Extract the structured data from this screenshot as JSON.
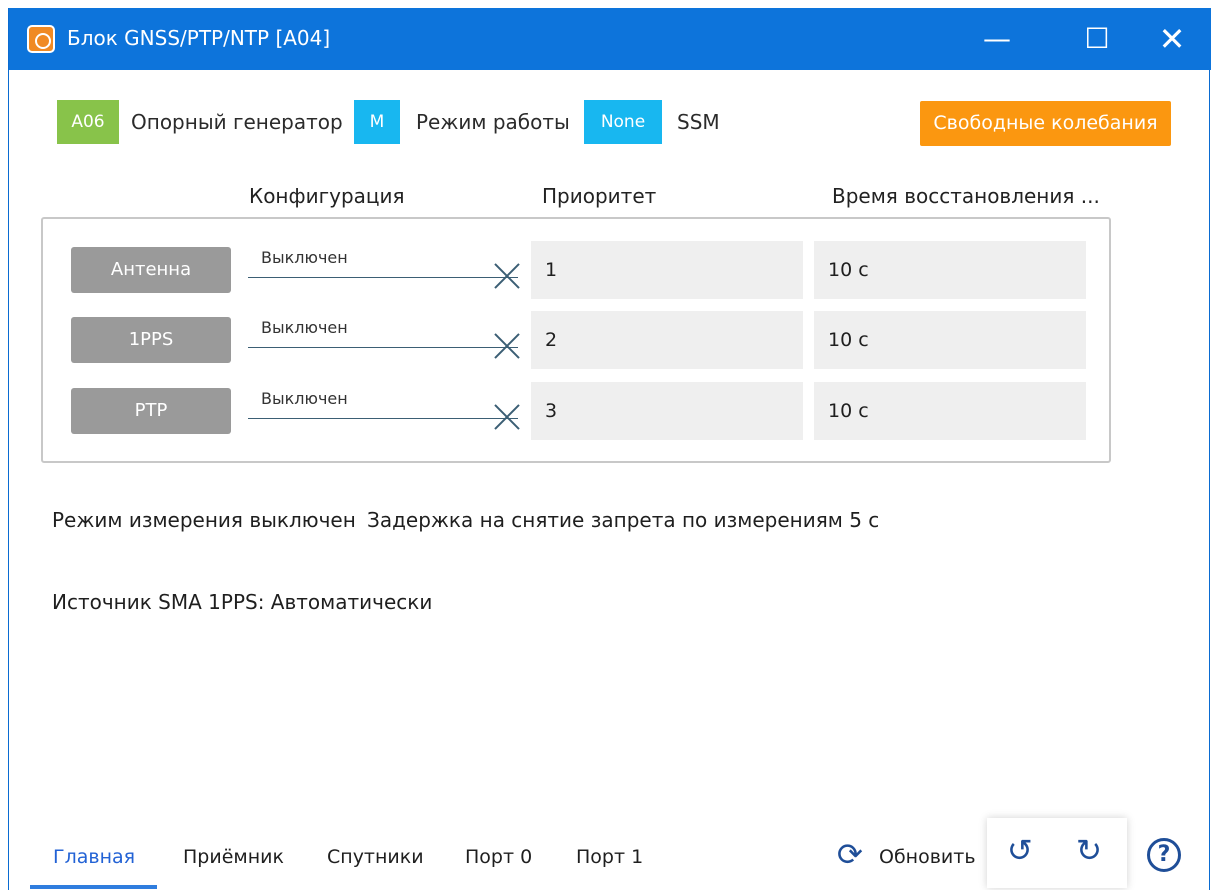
{
  "window": {
    "title": "Блок GNSS/PTP/NTP [A04]",
    "controls": {
      "minimize": "—",
      "maximize": "☐",
      "close": "✕"
    }
  },
  "status": {
    "generator_badge": "A06",
    "generator_label": "Опорный генератор",
    "mode_badge": "M",
    "mode_label": "Режим работы",
    "ssm_badge": "None",
    "ssm_label": "SSM",
    "action_button": "Свободные колебания"
  },
  "table": {
    "headers": {
      "configuration": "Конфигурация",
      "priority": "Приоритет",
      "recovery": "Время восстановления ..."
    },
    "rows": [
      {
        "source": "Антенна",
        "state": "Выключен",
        "priority": "1",
        "recovery": "10 с"
      },
      {
        "source": "1PPS",
        "state": "Выключен",
        "priority": "2",
        "recovery": "10 с"
      },
      {
        "source": "PTP",
        "state": "Выключен",
        "priority": "3",
        "recovery": "10 с"
      }
    ]
  },
  "info": {
    "measurement_mode": "Режим измерения выключен",
    "delay": "Задержка на снятие запрета по измерениям 5 с",
    "source": "Источник SMA 1PPS: Автоматически"
  },
  "tabs": [
    {
      "label": "Главная"
    },
    {
      "label": "Приёмник"
    },
    {
      "label": "Спутники"
    },
    {
      "label": "Порт 0"
    },
    {
      "label": "Порт 1"
    }
  ],
  "actions": {
    "refresh": "Обновить",
    "refresh_icon": "sync-icon",
    "undo_icon": "undo-icon",
    "redo_icon": "redo-icon",
    "help_icon": "help-icon",
    "help_symbol": "?"
  },
  "colors": {
    "titlebar": "#0d74db",
    "green": "#88c34a",
    "blue": "#18b7f0",
    "orange": "#fb9710",
    "accent": "#2262d5"
  }
}
